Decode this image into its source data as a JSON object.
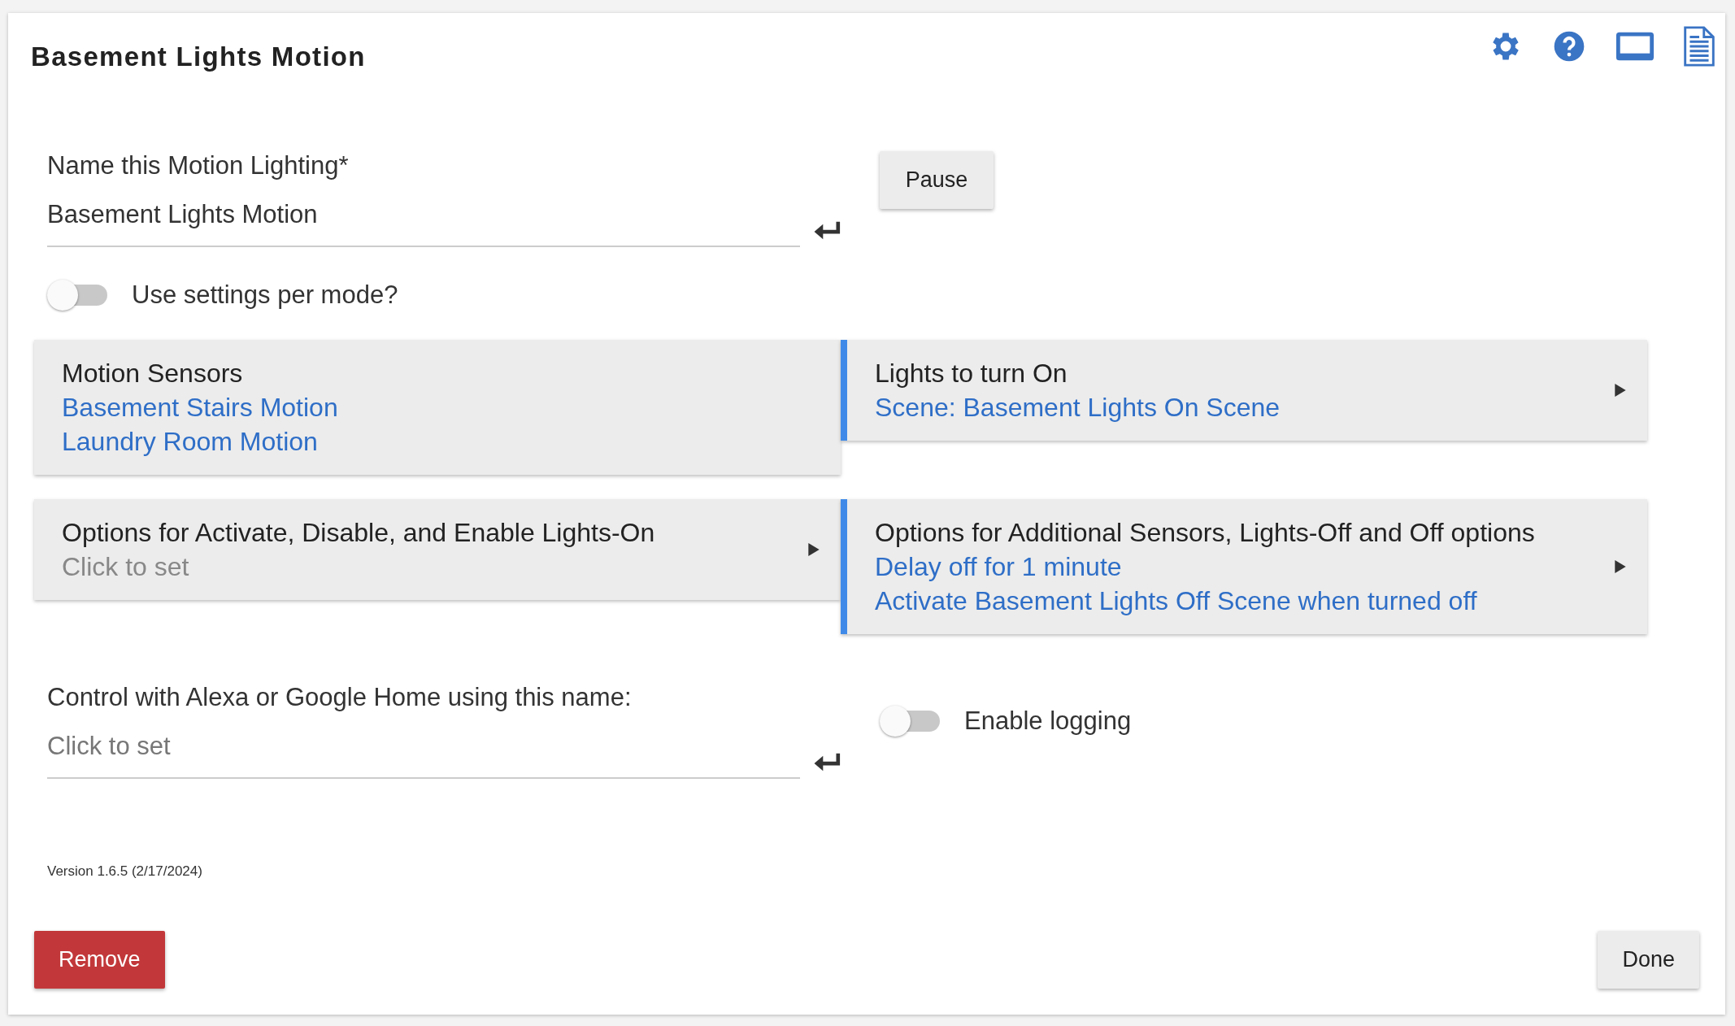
{
  "title": "Basement Lights Motion",
  "toolbar_icons": [
    {
      "kind": "gear"
    },
    {
      "kind": "help"
    },
    {
      "kind": "monitor"
    },
    {
      "kind": "document"
    }
  ],
  "name_field": {
    "label": "Name this Motion Lighting*",
    "value": "Basement Lights Motion"
  },
  "pause_button": "Pause",
  "mode_toggle": {
    "label": "Use settings per mode?",
    "on": false
  },
  "sections": [
    {
      "title": "Motion Sensors",
      "accent": false,
      "has_arrow": false,
      "lines": [
        {
          "kind": "link",
          "text": "Basement Stairs Motion"
        },
        {
          "kind": "link",
          "text": "Laundry Room Motion"
        }
      ]
    },
    {
      "title": "Lights to turn On",
      "accent": true,
      "has_arrow": true,
      "lines": [
        {
          "kind": "link",
          "text": "Scene: Basement Lights On Scene"
        }
      ]
    },
    {
      "title": "Options for Activate, Disable, and Enable Lights-On",
      "accent": false,
      "has_arrow": true,
      "lines": [
        {
          "kind": "hint",
          "text": "Click to set"
        }
      ]
    },
    {
      "title": "Options for Additional Sensors, Lights-Off and Off options",
      "accent": true,
      "has_arrow": true,
      "lines": [
        {
          "kind": "link",
          "text": "Delay off for 1 minute"
        },
        {
          "kind": "link",
          "text": "Activate Basement Lights Off Scene when turned off"
        }
      ]
    }
  ],
  "voice_field": {
    "label": "Control with Alexa or Google Home using this name:",
    "placeholder": "Click to set"
  },
  "logging_toggle": {
    "label": "Enable logging",
    "on": false
  },
  "version": "Version 1.6.5 (2/17/2024)",
  "buttons": [
    {
      "kind": "danger",
      "label": "Remove"
    },
    {
      "kind": "plain",
      "label": "Done"
    }
  ]
}
